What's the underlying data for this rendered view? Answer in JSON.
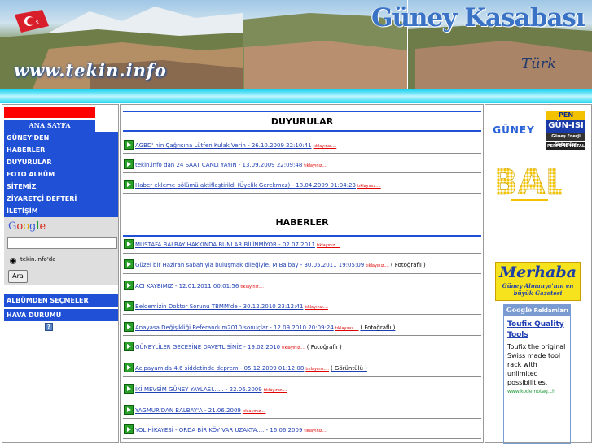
{
  "banner": {
    "site": "www.tekin.info",
    "title": "Güney Kasabası",
    "signature": "Türk"
  },
  "left": {
    "nav": [
      "ANA SAYFA",
      "GÜNEY'DEN",
      "HABERLER",
      "DUYURULAR",
      "FOTO ALBÜM",
      "SİTEMİZ",
      "ZİYARETÇİ DEFTERİ",
      "İLETİŞİM"
    ],
    "google": {
      "logo": "Google",
      "radio_label": "tekin.info'da",
      "button": "Ara"
    },
    "nav2": [
      "ALBÜMDEN SEÇMELER",
      "HAVA DURUMU"
    ]
  },
  "main": {
    "duyurular": {
      "title": "DUYURULAR",
      "items": [
        {
          "text": "AGBD' nin Çağrısına Lütfen Kulak Verin - 26.10.2009 22:10:41",
          "more": "tıklayınız...."
        },
        {
          "text": "tekin.info dan 24 SAAT CANLI YAYIN - 13.09.2009 22:09:48",
          "more": "tıklayınız...."
        },
        {
          "text": "Haber ekleme bölümü aktifleştirildi (Üyelik Gerekmez) - 18.04.2009 01:04:23",
          "more": "tıklayınız...."
        }
      ]
    },
    "haberler": {
      "title": "HABERLER",
      "items": [
        {
          "text": "MUSTAFA BALBAY HAKKINDA BUNLAR BİLİNMİYOR - 02.07.2011",
          "more": "tıklayınız....",
          "extra": ""
        },
        {
          "text": "Güzel bir Haziran sabahıyla buluşmak dileğiyle. M.Balbay - 30.05.2011 19:05:09",
          "more": "tıklayınız....",
          "extra": "( Fotoğraflı )"
        },
        {
          "text": "ACI KAYBIMIZ - 12.01.2011 00:01:56",
          "more": "tıklayınız....",
          "extra": ""
        },
        {
          "text": "Beldemizin Doktor Sorunu TBMM'de - 30.12.2010 23:12:41",
          "more": "tıklayınız....",
          "extra": ""
        },
        {
          "text": "Anayasa Değişikliği Referandum2010 sonuçlar - 12.09.2010 20:09:24",
          "more": "tıklayınız....",
          "extra": "( Fotoğraflı )"
        },
        {
          "text": "GÜNEYLİLER GECESİNE DAVETLİSİNİZ - 19.02.2010",
          "more": "tıklayınız....",
          "extra": "( Fotoğraflı )"
        },
        {
          "text": "Acıpayam'da 4.6 şiddetinde deprem - 05.12.2009 01:12:08",
          "more": "tıklayınız....",
          "extra": "( Görüntülü )"
        },
        {
          "text": "İKİ MEVSİM GÜNEY YAYLASI...... - 22.06.2009",
          "more": "tıklayınız....",
          "extra": ""
        },
        {
          "text": "YAĞMUR'DAN BALBAY'A - 21.06.2009",
          "more": "tıklayınız....",
          "extra": ""
        },
        {
          "text": "YOL HİKAYESİ - ORDA BİR KÖY VAR UZAKTA.... - 16.06.2009",
          "more": "tıklayınız....",
          "extra": ""
        }
      ]
    }
  },
  "right": {
    "guney_logo": "GÜNEY",
    "pen_logo": [
      "PEN",
      "GÜN-ISI",
      "Güneş Enerji Sistemleri",
      "PERFORE METAL"
    ],
    "bal": "BAL",
    "merhaba": {
      "title": "Merhaba",
      "subtitle": "Güney Almanya'nın en büyük Gazetesi"
    },
    "ad": {
      "header_brand": "Google",
      "header_label": "Reklamları",
      "title": "Toufix Quality Tools",
      "body": "Toufix the original Swiss made tool rack with unlimited possibilities.",
      "url": "www.kodemotag.ch"
    }
  },
  "colors": {
    "nav_blue": "#1f50d6",
    "stripe": "#1ad2ee",
    "link": "#1f3fb3",
    "more_red": "#e00000"
  }
}
